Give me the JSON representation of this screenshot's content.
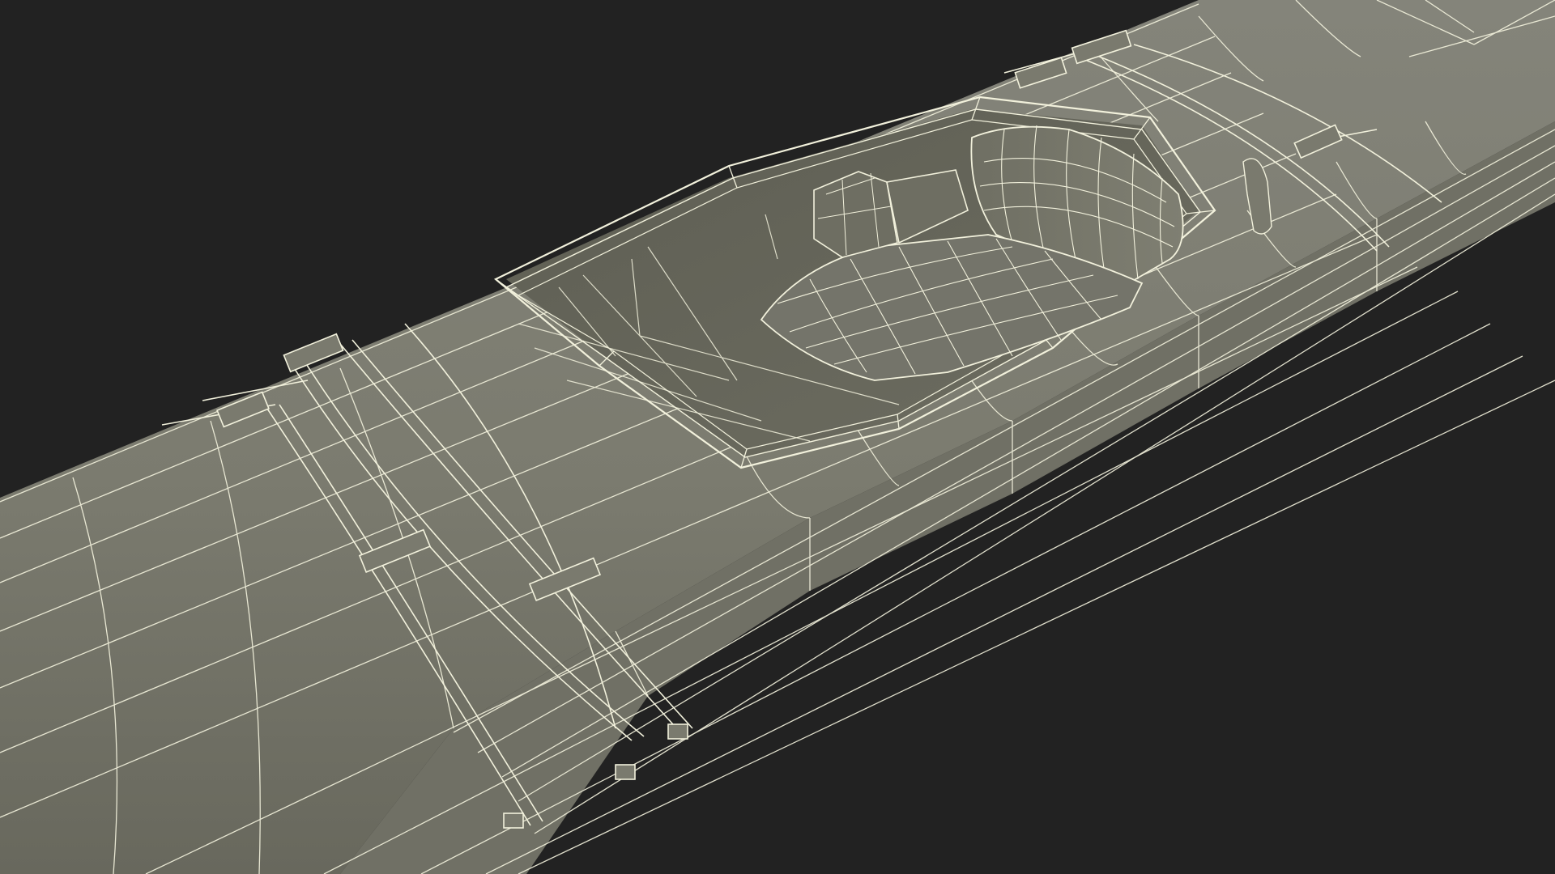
{
  "scene": {
    "subject": "kayak-wireframe-render",
    "background_color": "#222222",
    "surface_color": "#7d7d6f",
    "surface_shadow_color": "#6a6a5e",
    "cockpit_inner_color": "#66665a",
    "seat_color": "#76766a",
    "wire_color": "#f2f1dc",
    "icons": [
      "kayak-hull-icon",
      "cockpit-icon",
      "seat-icon",
      "deck-bungee-icon"
    ]
  }
}
